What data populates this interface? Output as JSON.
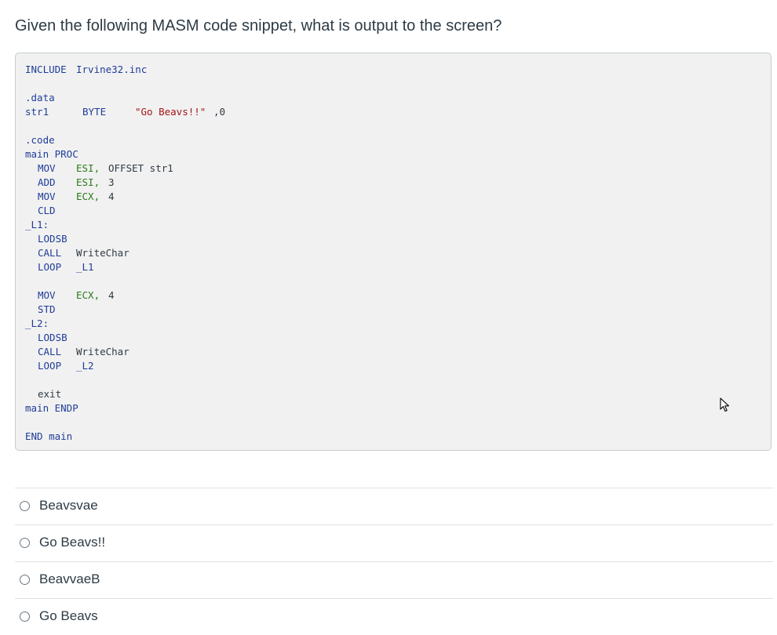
{
  "question": {
    "text": "Given the following MASM code snippet, what is output to the screen?"
  },
  "code": {
    "include": [
      "INCLUDE",
      "Irvine32.inc"
    ],
    "data_directive": ".data",
    "data_decl": [
      "str1",
      "BYTE",
      "\"Go Beavs!!\"",
      ",0"
    ],
    "code_directive": ".code",
    "main_proc": "main PROC",
    "block1": [
      [
        "MOV",
        "ESI,",
        "OFFSET str1"
      ],
      [
        "ADD",
        "ESI,",
        "3"
      ],
      [
        "MOV",
        "ECX,",
        "4"
      ],
      [
        "CLD",
        "",
        ""
      ]
    ],
    "label_l1": "_L1:",
    "loop1": [
      [
        "LODSB",
        ""
      ],
      [
        "CALL",
        "WriteChar"
      ],
      [
        "LOOP",
        "_L1"
      ]
    ],
    "block2": [
      [
        "MOV",
        "ECX,",
        "4"
      ],
      [
        "STD",
        "",
        ""
      ]
    ],
    "label_l2": "_L2:",
    "loop2": [
      [
        "LODSB",
        ""
      ],
      [
        "CALL",
        "WriteChar"
      ],
      [
        "LOOP",
        "_L2"
      ]
    ],
    "exit": "exit",
    "main_endp": "main ENDP",
    "end_main": "END main"
  },
  "answers": [
    {
      "label": "Beavsvae"
    },
    {
      "label": "Go Beavs!!"
    },
    {
      "label": "BeavvaeB"
    },
    {
      "label": "Go Beavs"
    }
  ],
  "icons": {
    "cursor": "mouse-pointer-icon"
  },
  "colors": {
    "keyword": "#1f3d99",
    "register": "#2c7a1a",
    "string": "#a31515",
    "code_bg": "#f1f1f1"
  }
}
